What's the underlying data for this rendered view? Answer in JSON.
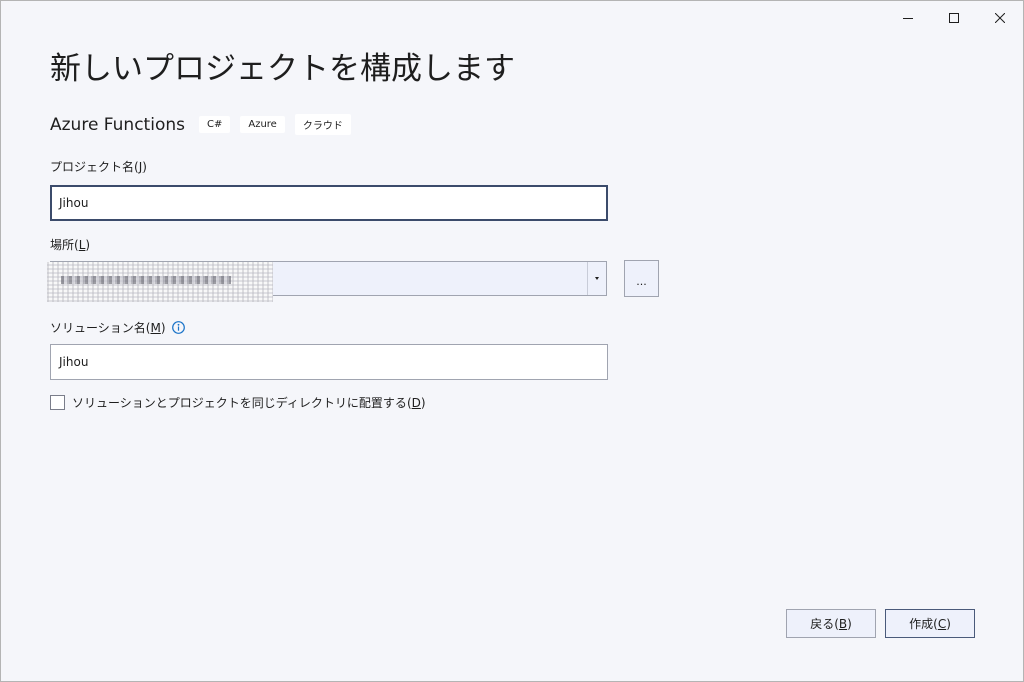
{
  "window": {
    "controls": [
      "minimize",
      "maximize",
      "close"
    ]
  },
  "page": {
    "title": "新しいプロジェクトを構成します"
  },
  "template": {
    "name": "Azure Functions",
    "tags": [
      "C#",
      "Azure",
      "クラウド"
    ]
  },
  "project_name": {
    "label": "プロジェクト名",
    "accesskey": "J",
    "value": "Jihou"
  },
  "location": {
    "label": "場所",
    "accesskey": "L",
    "value": "",
    "browse_label": "..."
  },
  "solution_name": {
    "label": "ソリューション名",
    "accesskey": "M",
    "value": "Jihou",
    "info_icon": "info-icon"
  },
  "same_directory": {
    "label": "ソリューションとプロジェクトを同じディレクトリに配置する",
    "accesskey": "D",
    "checked": false
  },
  "buttons": {
    "back_label": "戻る",
    "back_accesskey": "B",
    "create_label": "作成",
    "create_accesskey": "C"
  },
  "colors": {
    "window_bg": "#f5f6fa",
    "focus_border": "#3b4b6b",
    "info_accent": "#1a73c8"
  }
}
